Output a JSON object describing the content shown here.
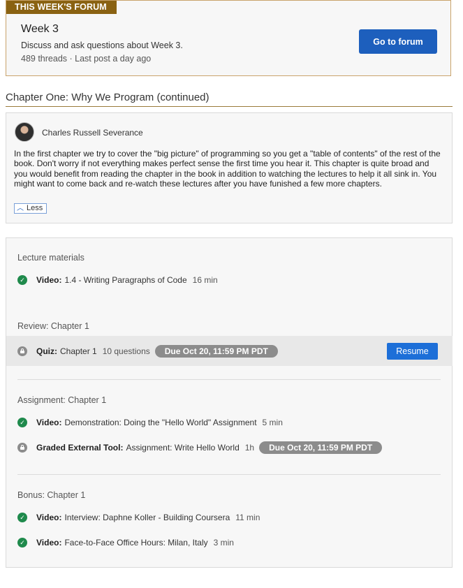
{
  "forum": {
    "tag": "THIS WEEK'S FORUM",
    "title": "Week 3",
    "description": "Discuss and ask questions about Week 3.",
    "meta": "489 threads · Last post a day ago",
    "button_label": "Go to forum"
  },
  "chapter": {
    "title": "Chapter One: Why We Program (continued)"
  },
  "instructor": {
    "name": "Charles Russell Severance",
    "description": "In the first chapter we try to cover the \"big picture\" of programming so you get a \"table of contents\" of the rest of the book. Don't worry if not everything makes perfect sense the first time you hear it. This chapter is quite broad and you would benefit from reading the chapter in the book in addition to watching the lectures to help it all sink in. You might want to come back and re-watch these lectures after you have funished a few more chapters.",
    "less_label": "Less"
  },
  "sections": [
    {
      "title": "Lecture materials",
      "items": [
        {
          "type": "Video:",
          "name": "1.4 - Writing Paragraphs of Code",
          "meta": "16 min",
          "status": "completed"
        }
      ]
    },
    {
      "title": "Review: Chapter 1",
      "items": [
        {
          "type": "Quiz:",
          "name": "Chapter 1",
          "meta": "10 questions",
          "due": "Due Oct 20, 11:59 PM PDT",
          "status": "locked",
          "action": "Resume"
        }
      ]
    },
    {
      "title": "Assignment: Chapter 1",
      "items": [
        {
          "type": "Video:",
          "name": "Demonstration: Doing the \"Hello World\" Assignment",
          "meta": "5 min",
          "status": "completed"
        },
        {
          "type": "Graded External Tool:",
          "name": "Assignment: Write Hello World",
          "meta": "1h",
          "due": "Due Oct 20, 11:59 PM PDT",
          "status": "locked"
        }
      ]
    },
    {
      "title": "Bonus: Chapter 1",
      "items": [
        {
          "type": "Video:",
          "name": "Interview: Daphne Koller - Building Coursera",
          "meta": "11 min",
          "status": "completed"
        },
        {
          "type": "Video:",
          "name": "Face-to-Face Office Hours: Milan, Italy",
          "meta": "3 min",
          "status": "completed"
        }
      ]
    }
  ],
  "colors": {
    "brand_gold": "#8a6212",
    "primary_button": "#1d5fbd",
    "check_green": "#1f8a4c",
    "lock_gray": "#8c8c8c"
  }
}
